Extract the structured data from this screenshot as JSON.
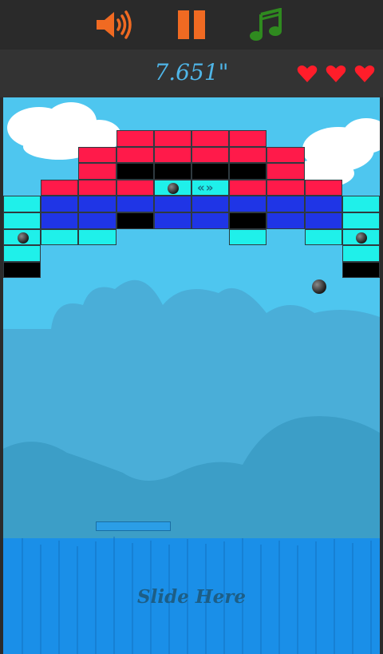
{
  "toolbar": {
    "sound_icon": "speaker-volume-icon",
    "pause_icon": "pause-icon",
    "music_icon": "music-note-icon",
    "sound_color": "#f06a22",
    "pause_color": "#f06a22",
    "music_color": "#2f8a1f"
  },
  "hud": {
    "timer": "7.651\"",
    "lives": 3,
    "heart_color": "#ff1d2a"
  },
  "bricks_grid": {
    "columns": 10,
    "rows": [
      [
        "",
        "",
        "",
        "red",
        "red",
        "red",
        "red",
        "",
        "",
        ""
      ],
      [
        "",
        "",
        "red",
        "red",
        "red",
        "red",
        "red",
        "red",
        "",
        ""
      ],
      [
        "",
        "",
        "red",
        "black",
        "black",
        "black",
        "black",
        "red",
        "",
        ""
      ],
      [
        "",
        "red",
        "red",
        "red",
        "cyan-ball",
        "cyan-arrows",
        "red",
        "red",
        "red",
        ""
      ],
      [
        "cyan",
        "blue",
        "blue",
        "blue",
        "blue",
        "blue",
        "blue",
        "blue",
        "blue",
        "cyan"
      ],
      [
        "cyan",
        "blue",
        "blue",
        "black",
        "blue",
        "blue",
        "black",
        "blue",
        "blue",
        "cyan"
      ],
      [
        "cyan-ball",
        "cyan",
        "cyan",
        "",
        "",
        "",
        "cyan",
        "",
        "cyan",
        "cyan-ball"
      ],
      [
        "cyan",
        "",
        "",
        "",
        "",
        "",
        "",
        "",
        "",
        "cyan"
      ],
      [
        "black",
        "",
        "",
        "",
        "",
        "",
        "",
        "",
        "",
        "black"
      ]
    ]
  },
  "colors": {
    "red": "#ff1a4a",
    "blue": "#1f35e6",
    "cyan": "#1ff0ea",
    "black": "#000000",
    "sky": "#4ec6ef",
    "hill_light": "#4aaed8",
    "hill_dark": "#3c9ec7",
    "fence": "#1a8fe8"
  },
  "ball_in_play": true,
  "slide_label": "Slide Here"
}
